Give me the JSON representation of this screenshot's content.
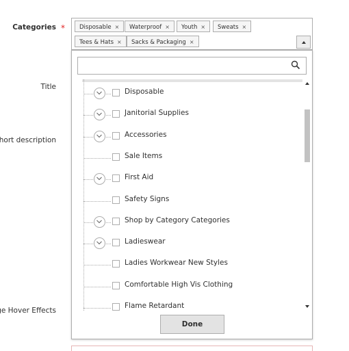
{
  "form": {
    "labels": {
      "categories": "Categories",
      "title": "Title",
      "short_description": "Short description",
      "image_hover": "Image Hover Effects"
    },
    "required_mark": "*"
  },
  "selected_tags": [
    {
      "label": "Disposable",
      "remove": "×"
    },
    {
      "label": "Waterproof",
      "remove": "×"
    },
    {
      "label": "Youth",
      "remove": "×"
    },
    {
      "label": "Sweats",
      "remove": "×"
    },
    {
      "label": "Tees & Hats",
      "remove": "×"
    },
    {
      "label": "Sacks & Packaging",
      "remove": "×"
    }
  ],
  "search": {
    "placeholder": "",
    "value": "",
    "icon": "search-icon"
  },
  "tree_items": [
    {
      "label": "Disposable",
      "expandable": true
    },
    {
      "label": "Janitorial Supplies",
      "expandable": true
    },
    {
      "label": "Accessories",
      "expandable": true
    },
    {
      "label": "Sale Items",
      "expandable": false
    },
    {
      "label": "First Aid",
      "expandable": true
    },
    {
      "label": "Safety Signs",
      "expandable": false
    },
    {
      "label": "Shop by Category Categories",
      "expandable": true
    },
    {
      "label": "Ladieswear",
      "expandable": true
    },
    {
      "label": "Ladies Workwear New Styles",
      "expandable": false
    },
    {
      "label": "Comfortable High Vis Clothing",
      "expandable": false
    },
    {
      "label": "Flame Retardant",
      "expandable": false
    }
  ],
  "done_button": "Done",
  "colors": {
    "required": "#e22626",
    "border": "#adadad",
    "button_bg": "#e3e3e3"
  }
}
